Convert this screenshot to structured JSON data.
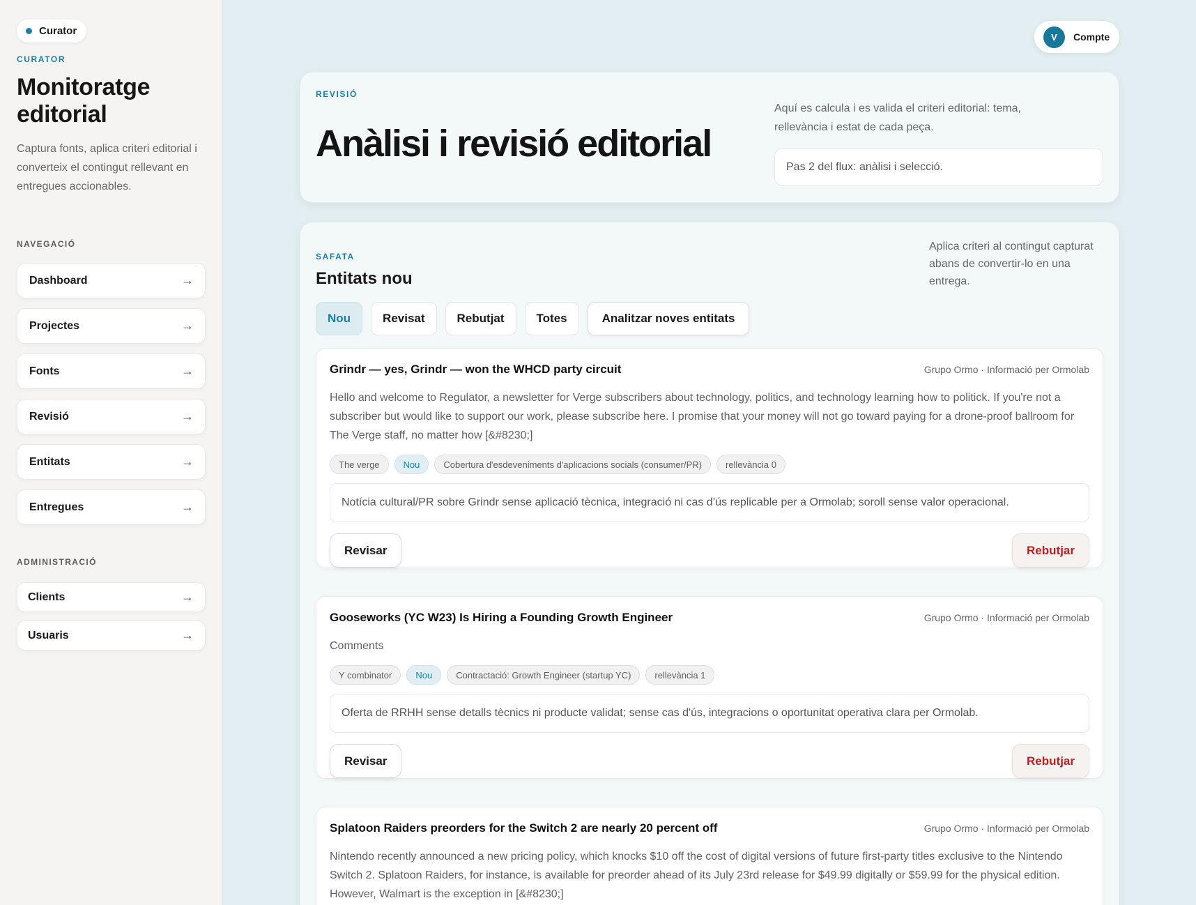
{
  "sidebar": {
    "brand": "Curator",
    "eyebrow": "CURATOR",
    "title": "Monitoratge editorial",
    "description": "Captura fonts, aplica criteri editorial i converteix el contingut rellevant en entregues accionables.",
    "nav_heading": "NAVEGACIÓ",
    "nav_items": [
      {
        "label": "Dashboard"
      },
      {
        "label": "Projectes"
      },
      {
        "label": "Fonts"
      },
      {
        "label": "Revisió"
      },
      {
        "label": "Entitats"
      },
      {
        "label": "Entregues"
      }
    ],
    "admin_heading": "ADMINISTRACIÓ",
    "admin_items": [
      {
        "label": "Clients"
      },
      {
        "label": "Usuaris"
      }
    ],
    "arrow_glyph": "→"
  },
  "account": {
    "initial": "V",
    "label": "Compte"
  },
  "header": {
    "eyebrow": "REVISIÓ",
    "title": "Anàlisi i revisió editorial",
    "description": "Aquí es calcula i es valida el criteri editorial: tema, rellevància i estat de cada peça.",
    "step": "Pas 2 del flux: anàlisi i selecció."
  },
  "panel": {
    "eyebrow": "SAFATA",
    "title": "Entitats nou",
    "description": "Aplica criteri al contingut capturat abans de convertir-lo en una entrega.",
    "tabs": [
      {
        "label": "Nou",
        "active": true
      },
      {
        "label": "Revisat"
      },
      {
        "label": "Rebutjat"
      },
      {
        "label": "Totes"
      }
    ],
    "analyze_button": "Analitzar noves entitats"
  },
  "entities": [
    {
      "title": "Grindr — yes, Grindr — won the WHCD party circuit",
      "meta": "Grupo Ormo · Informació per Ormolab",
      "body": "Hello and welcome to Regulator, a newsletter for Verge subscribers about technology, politics, and technology learning how to politick. If you're not a subscriber but would like to support our work, please subscribe here. I promise that your money will not go toward paying for a drone-proof ballroom for The Verge staff, no matter how [&#8230;]",
      "chips": [
        "The verge",
        "Nou",
        "Cobertura d'esdeveniments d'aplicacions socials (consumer/PR)",
        "rellevància 0"
      ],
      "note": "Notícia cultural/PR sobre Grindr sense aplicació tècnica, integració ni cas d’ús replicable per a Ormolab; soroll sense valor operacional.",
      "review_label": "Revisar",
      "reject_label": "Rebutjar"
    },
    {
      "title": "Gooseworks (YC W23) Is Hiring a Founding Growth Engineer",
      "meta": "Grupo Ormo · Informació per Ormolab",
      "body": "Comments",
      "chips": [
        "Y combinator",
        "Nou",
        "Contractació: Growth Engineer (startup YC)",
        "rellevància 1"
      ],
      "note": "Oferta de RRHH sense detalls tècnics ni producte validat; sense cas d'ús, integracions o oportunitat operativa clara per Ormolab.",
      "review_label": "Revisar",
      "reject_label": "Rebutjar"
    },
    {
      "title": "Splatoon Raiders preorders for the Switch 2 are nearly 20 percent off",
      "meta": "Grupo Ormo · Informació per Ormolab",
      "body": "Nintendo recently announced a new pricing policy, which knocks $10 off the cost of digital versions of future first-party titles exclusive to the Nintendo Switch 2. Splatoon Raiders, for instance, is available for preorder ahead of its July 23rd release for $49.99 digitally or $59.99 for the physical edition. However, Walmart is the exception in [&#8230;]"
    }
  ],
  "colors": {
    "accent": "#1a7fa0",
    "reject": "#b22424",
    "background": "#e2eef1",
    "sidebar": "#f6f4f2"
  }
}
